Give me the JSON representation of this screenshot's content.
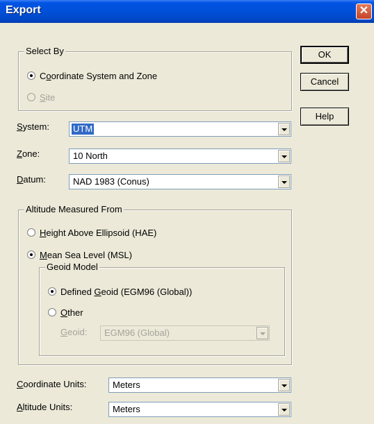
{
  "window": {
    "title": "Export",
    "close_glyph": "✕"
  },
  "buttons": {
    "ok": "OK",
    "cancel": "Cancel",
    "help": "Help"
  },
  "select_by": {
    "legend": "Select By",
    "option1": {
      "pre": "C",
      "u": "o",
      "post": "ordinate System and Zone",
      "selected": true
    },
    "option2": {
      "u": "S",
      "post": "ite",
      "enabled": false
    }
  },
  "fields": {
    "system": {
      "u": "S",
      "rest": "ystem:",
      "value": "UTM"
    },
    "zone": {
      "u": "Z",
      "rest": "one:",
      "value": "10 North"
    },
    "datum": {
      "u": "D",
      "rest": "atum:",
      "value": "NAD 1983 (Conus)"
    }
  },
  "altitude": {
    "legend": "Altitude Measured From",
    "hae": {
      "u": "H",
      "rest": "eight Above Ellipsoid (HAE)",
      "selected": false
    },
    "msl": {
      "u": "M",
      "rest": "ean Sea Level (MSL)",
      "selected": true
    },
    "geoid_model": {
      "legend": "Geoid Model",
      "defined": {
        "pre": "Defined ",
        "u": "G",
        "post": "eoid (EGM96 (Global))",
        "selected": true
      },
      "other": {
        "u": "O",
        "rest": "ther",
        "selected": false
      },
      "geoid_label": {
        "u": "G",
        "rest": "eoid:"
      },
      "geoid_value": "EGM96 (Global)"
    }
  },
  "units": {
    "coordinate": {
      "u": "C",
      "rest": "oordinate Units:",
      "value": "Meters"
    },
    "altitude": {
      "u": "A",
      "rest": "ltitude Units:",
      "value": "Meters"
    }
  }
}
